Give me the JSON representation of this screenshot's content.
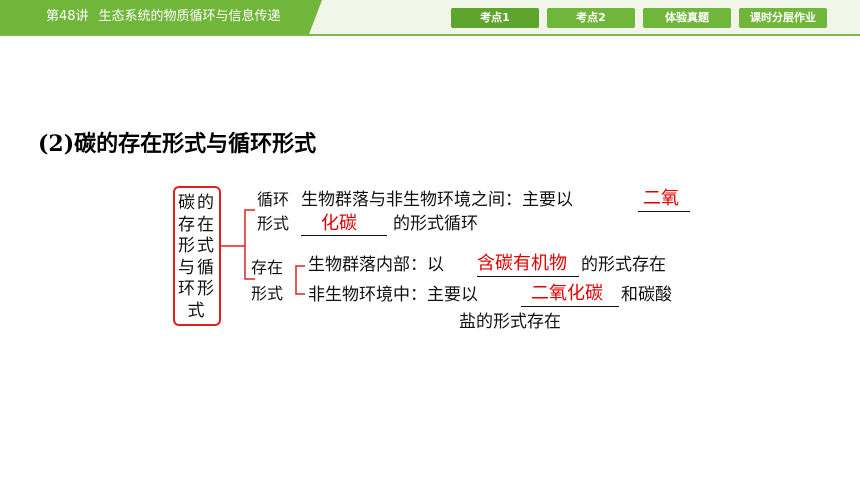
{
  "header": {
    "lesson": "第48讲",
    "title": "生态系统的物质循环与信息传递",
    "tabs": [
      {
        "label": "考点1"
      },
      {
        "label": "考点2"
      },
      {
        "label": "体验真题"
      },
      {
        "label": "课时分层作业"
      }
    ],
    "colors": {
      "accent": "#6fb63a",
      "answer": "#e00000"
    }
  },
  "section": {
    "heading": "(2)碳的存在形式与循环形式"
  },
  "figure": {
    "root_lines": [
      "碳的",
      "存在",
      "形式",
      "与循",
      "环形",
      "式"
    ],
    "circulation": {
      "label_line1": "循环",
      "label_line2": "形式",
      "text_a": "生物群落与非生物环境之间：主要以",
      "answer_a1": "二氧",
      "answer_a2": "化碳",
      "text_b": "的形式循环"
    },
    "existence": {
      "label_line1": "存在",
      "label_line2": "形式",
      "row1_prefix": "生物群落内部：以",
      "row1_answer": "含碳有机物",
      "row1_suffix": "的形式存在",
      "row2_prefix": "非生物环境中：主要以",
      "row2_answer": "二氧化碳",
      "row2_suffix": "和碳酸",
      "row3_text": "盐的形式存在"
    }
  }
}
